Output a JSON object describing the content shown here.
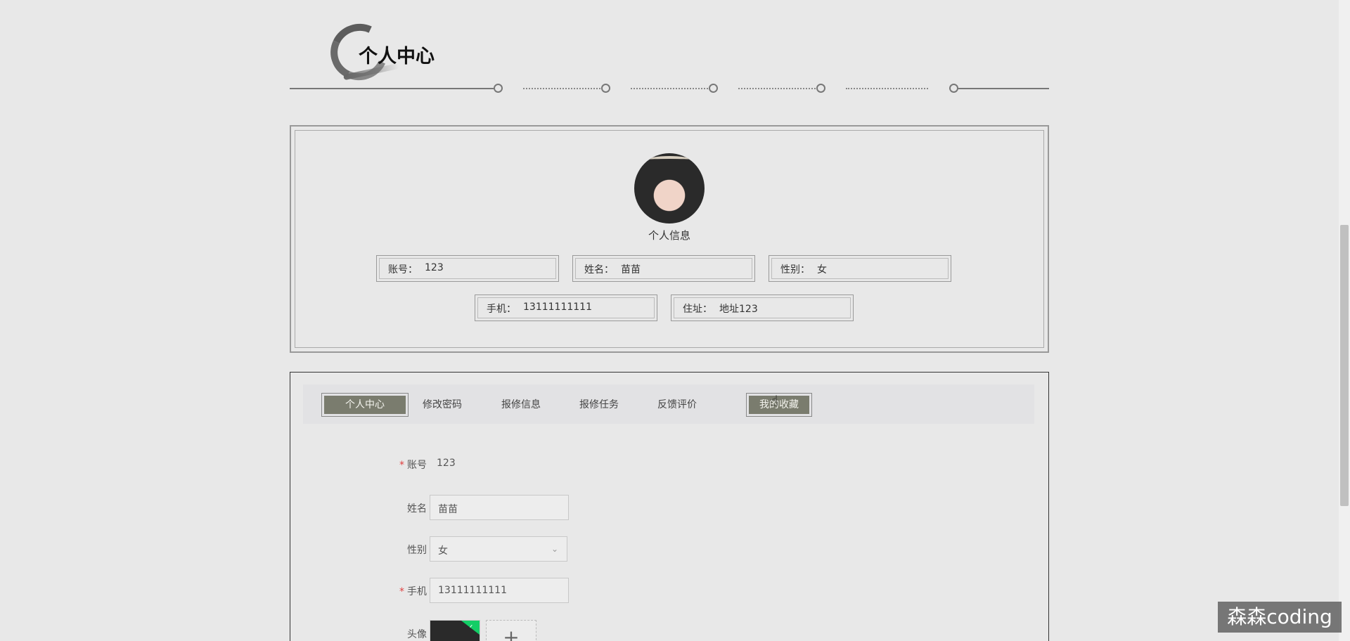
{
  "page": {
    "title": "个人中心"
  },
  "profile": {
    "section_label": "个人信息",
    "fields": [
      {
        "label": "账号：",
        "value": "123"
      },
      {
        "label": "姓名：",
        "value": "苗苗"
      },
      {
        "label": "性别：",
        "value": "女"
      },
      {
        "label": "手机：",
        "value": "13111111111"
      },
      {
        "label": "住址：",
        "value": "地址123"
      }
    ]
  },
  "tabs": [
    {
      "label": "个人中心",
      "active": true
    },
    {
      "label": "修改密码",
      "active": false
    },
    {
      "label": "报修信息",
      "active": false
    },
    {
      "label": "报修任务",
      "active": false
    },
    {
      "label": "反馈评价",
      "active": false
    },
    {
      "label": "我的收藏",
      "active": true
    }
  ],
  "form": {
    "account": {
      "label": "账号",
      "required": "*",
      "value": "123"
    },
    "name": {
      "label": "姓名",
      "value": "苗苗"
    },
    "gender": {
      "label": "性别",
      "value": "女"
    },
    "phone": {
      "label": "手机",
      "required": "*",
      "value": "13111111111"
    },
    "avatar": {
      "label": "头像",
      "add_symbol": "+"
    }
  },
  "watermark": {
    "text": "森森coding"
  },
  "colors": {
    "accent": "#7a7c6e",
    "background": "#e8e8e8",
    "required": "#e04040",
    "upload_success": "#13ce66"
  },
  "icons": [
    "brush-circle-icon",
    "check-icon",
    "chevron-down-icon",
    "hand-cursor-icon"
  ]
}
